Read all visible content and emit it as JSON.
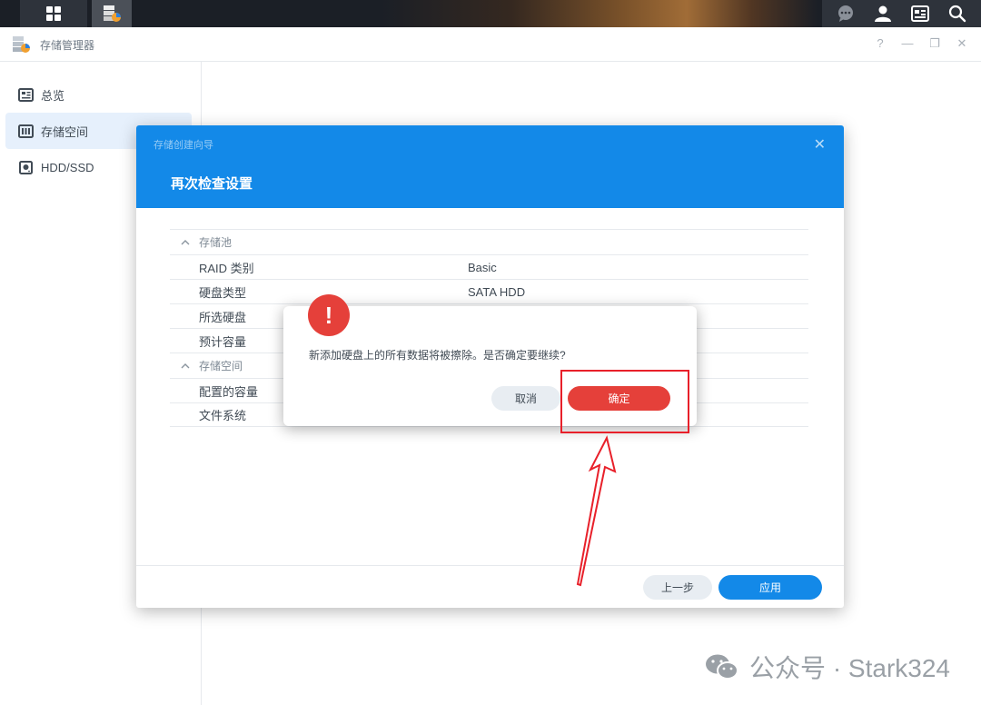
{
  "taskbar": {
    "icons": [
      "apps-grid-icon",
      "storage-manager-icon",
      "chat-icon",
      "user-icon",
      "widgets-icon",
      "search-icon"
    ]
  },
  "window": {
    "title": "存储管理器",
    "controls": [
      "?",
      "—",
      "❐",
      "✕"
    ]
  },
  "sidebar": {
    "items": [
      {
        "label": "总览",
        "icon": "overview-icon"
      },
      {
        "label": "存储空间",
        "icon": "storage-icon",
        "active": true
      },
      {
        "label": "HDD/SSD",
        "icon": "disk-icon"
      }
    ]
  },
  "wizard": {
    "subtitle": "存储创建向导",
    "title": "再次检查设置",
    "sections": [
      {
        "label": "存储池",
        "rows": [
          {
            "key": "RAID 类别",
            "value": "Basic"
          },
          {
            "key": "硬盘类型",
            "value": "SATA HDD"
          },
          {
            "key": "所选硬盘",
            "value": ""
          },
          {
            "key": "预计容量",
            "value": ""
          }
        ]
      },
      {
        "label": "存储空间",
        "rows": [
          {
            "key": "配置的容量",
            "value": ""
          },
          {
            "key": "文件系统",
            "value": ""
          }
        ]
      }
    ],
    "prev_label": "上一步",
    "apply_label": "应用"
  },
  "confirm": {
    "icon": "!",
    "message": "新添加硬盘上的所有数据将被擦除。是否确定要继续?",
    "cancel_label": "取消",
    "ok_label": "确定"
  },
  "colors": {
    "accent": "#1389e8",
    "danger": "#e5403a",
    "annotation": "#e8202a"
  },
  "watermark": {
    "text": "公众号 · Stark324"
  }
}
